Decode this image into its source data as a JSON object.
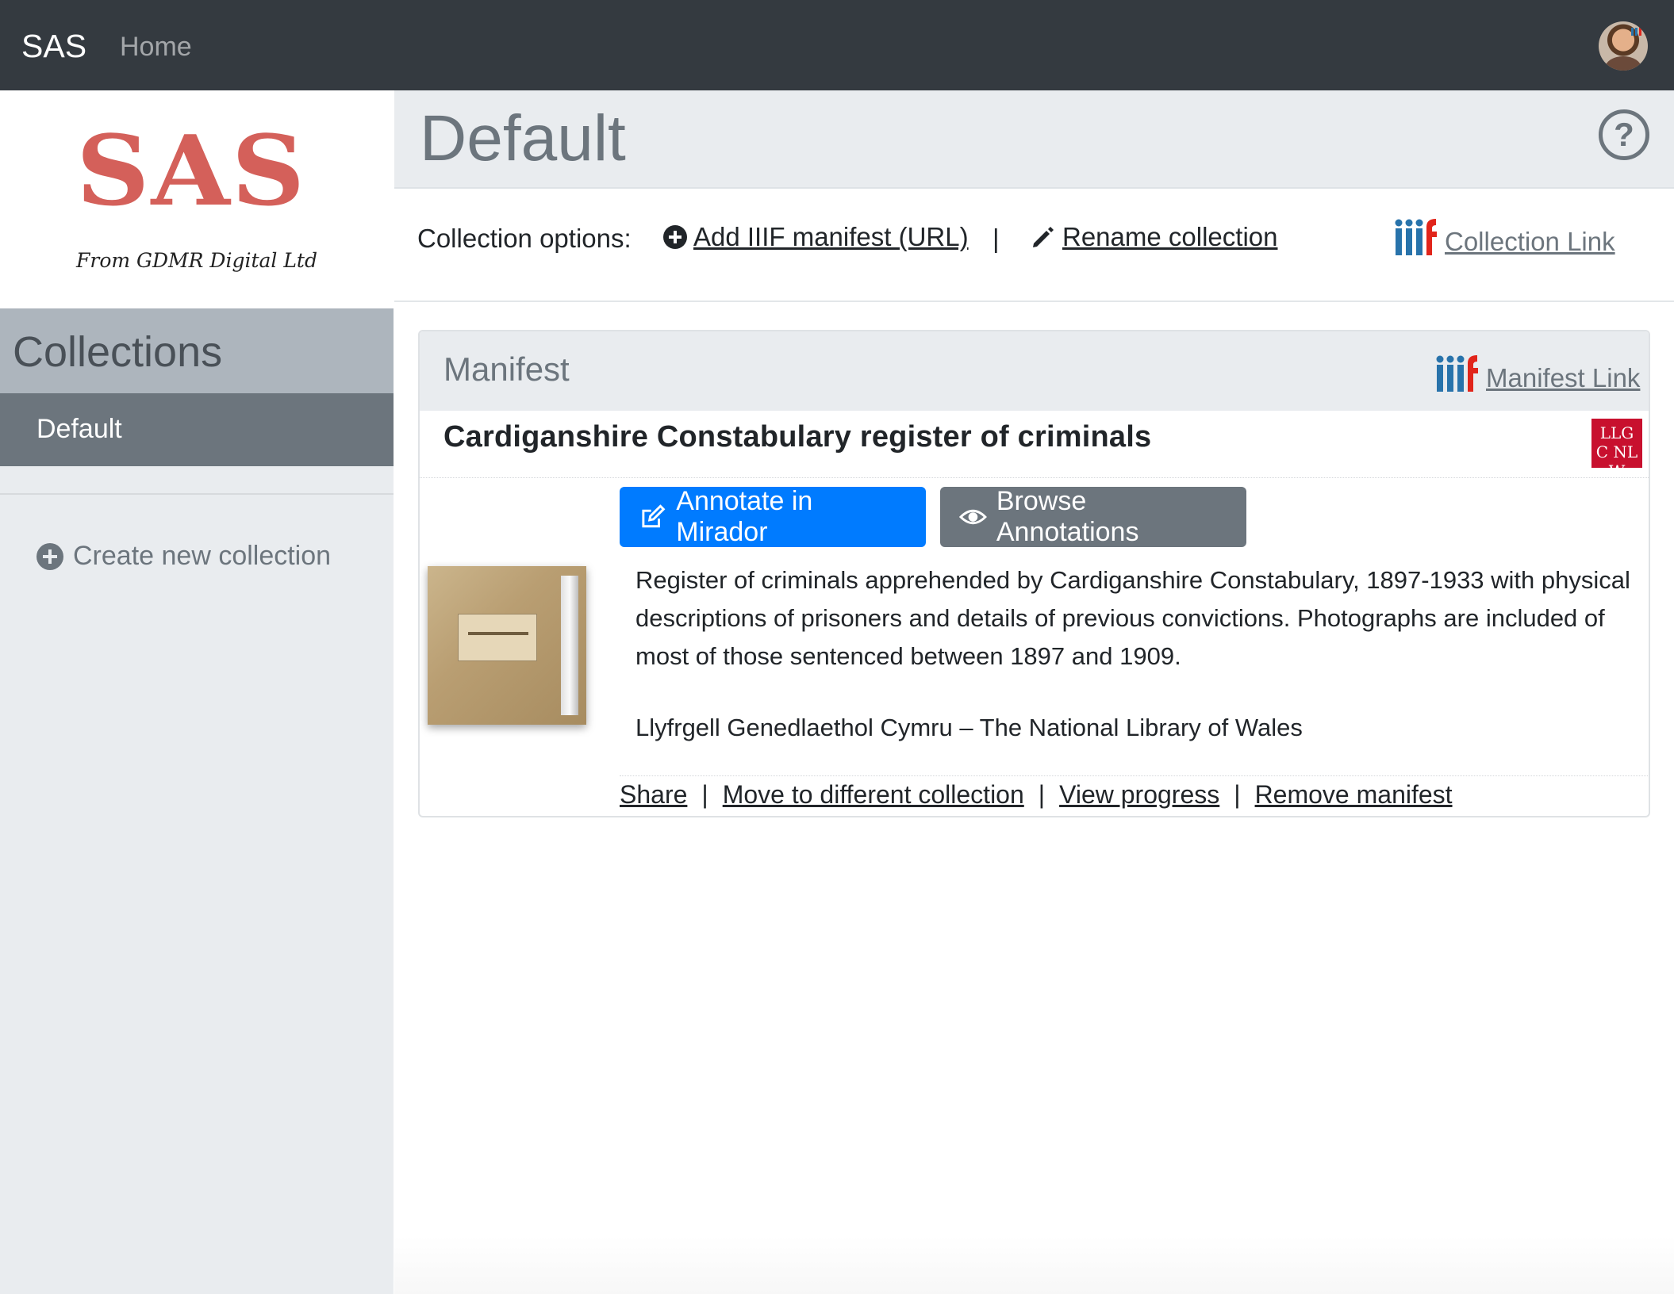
{
  "navbar": {
    "brand": "SAS",
    "home": "Home"
  },
  "sidebar": {
    "logo_text": "SAS",
    "logo_subtitle": "From GDMR Digital Ltd",
    "collections_heading": "Collections",
    "items": [
      {
        "label": "Default"
      }
    ],
    "create_new": "Create new collection"
  },
  "page": {
    "title": "Default",
    "help_glyph": "?"
  },
  "options": {
    "label": "Collection options:",
    "add_manifest": "Add IIIF manifest (URL)",
    "separator": "|",
    "rename": "Rename collection",
    "collection_link": "Collection Link"
  },
  "manifest": {
    "header": "Manifest",
    "manifest_link": "Manifest Link",
    "title": "Cardiganshire Constabulary register of criminals",
    "institution_logo": "LLGC NLW",
    "buttons": {
      "annotate": "Annotate in Mirador",
      "browse": "Browse Annotations"
    },
    "description": "Register of criminals apprehended by Cardiganshire Constabulary, 1897-1933 with physical descriptions of prisoners and details of previous convictions. Photographs are included of most of those sentenced between 1897 and 1909.",
    "attribution": "Llyfrgell Genedlaethol Cymru – The National Library of Wales",
    "actions": {
      "share": "Share",
      "move": "Move to different collection",
      "progress": "View progress",
      "remove": "Remove manifest",
      "sep": "|"
    }
  },
  "colors": {
    "navbar": "#343a40",
    "primary": "#007bff",
    "secondary": "#6c757d",
    "logo_red": "#d4605a",
    "iiif_red": "#e1251b",
    "iiif_blue": "#2873ab"
  },
  "icons": [
    "avatar",
    "help-icon",
    "plus-circle-icon",
    "pencil-icon",
    "iiif-logo-icon",
    "edit-icon",
    "eye-icon",
    "nlw-logo"
  ]
}
